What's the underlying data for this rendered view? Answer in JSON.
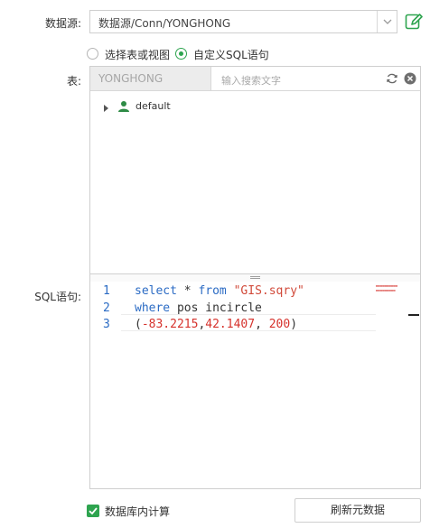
{
  "datasource": {
    "label": "数据源:",
    "value": "数据源/Conn/YONGHONG",
    "dropdown_icon": "chevron-down-icon",
    "edit_icon": "edit-icon"
  },
  "mode": {
    "options": [
      {
        "label": "选择表或视图",
        "selected": false
      },
      {
        "label": "自定义SQL语句",
        "selected": true
      }
    ]
  },
  "table": {
    "label": "表:",
    "schema": "YONGHONG",
    "search_placeholder": "输入搜索文字",
    "tree": [
      {
        "label": "default",
        "icon": "user-icon",
        "expanded": false
      }
    ]
  },
  "sql": {
    "label": "SQL语句:",
    "line_numbers": [
      "1",
      "2",
      "3"
    ],
    "lines": [
      [
        {
          "t": "select",
          "c": "kw"
        },
        {
          "t": " * ",
          "c": "pl"
        },
        {
          "t": "from",
          "c": "kw"
        },
        {
          "t": " ",
          "c": "pl"
        },
        {
          "t": "\"GIS.sqry\"",
          "c": "str"
        }
      ],
      [
        {
          "t": "where",
          "c": "kw"
        },
        {
          "t": " pos incircle",
          "c": "pl"
        }
      ],
      [
        {
          "t": "(",
          "c": "pl"
        },
        {
          "t": "-83.2215",
          "c": "num"
        },
        {
          "t": ",",
          "c": "pl"
        },
        {
          "t": "42.1407",
          "c": "num"
        },
        {
          "t": ", ",
          "c": "pl"
        },
        {
          "t": "200",
          "c": "num"
        },
        {
          "t": ")",
          "c": "pl"
        }
      ]
    ]
  },
  "footer": {
    "checkbox_label": "数据库内计算",
    "checkbox_checked": true,
    "refresh_button": "刷新元数据"
  },
  "colors": {
    "accent": "#2ea44f",
    "keyword": "#2b6bc4",
    "string": "#d14a3a",
    "number": "#d6322c"
  }
}
